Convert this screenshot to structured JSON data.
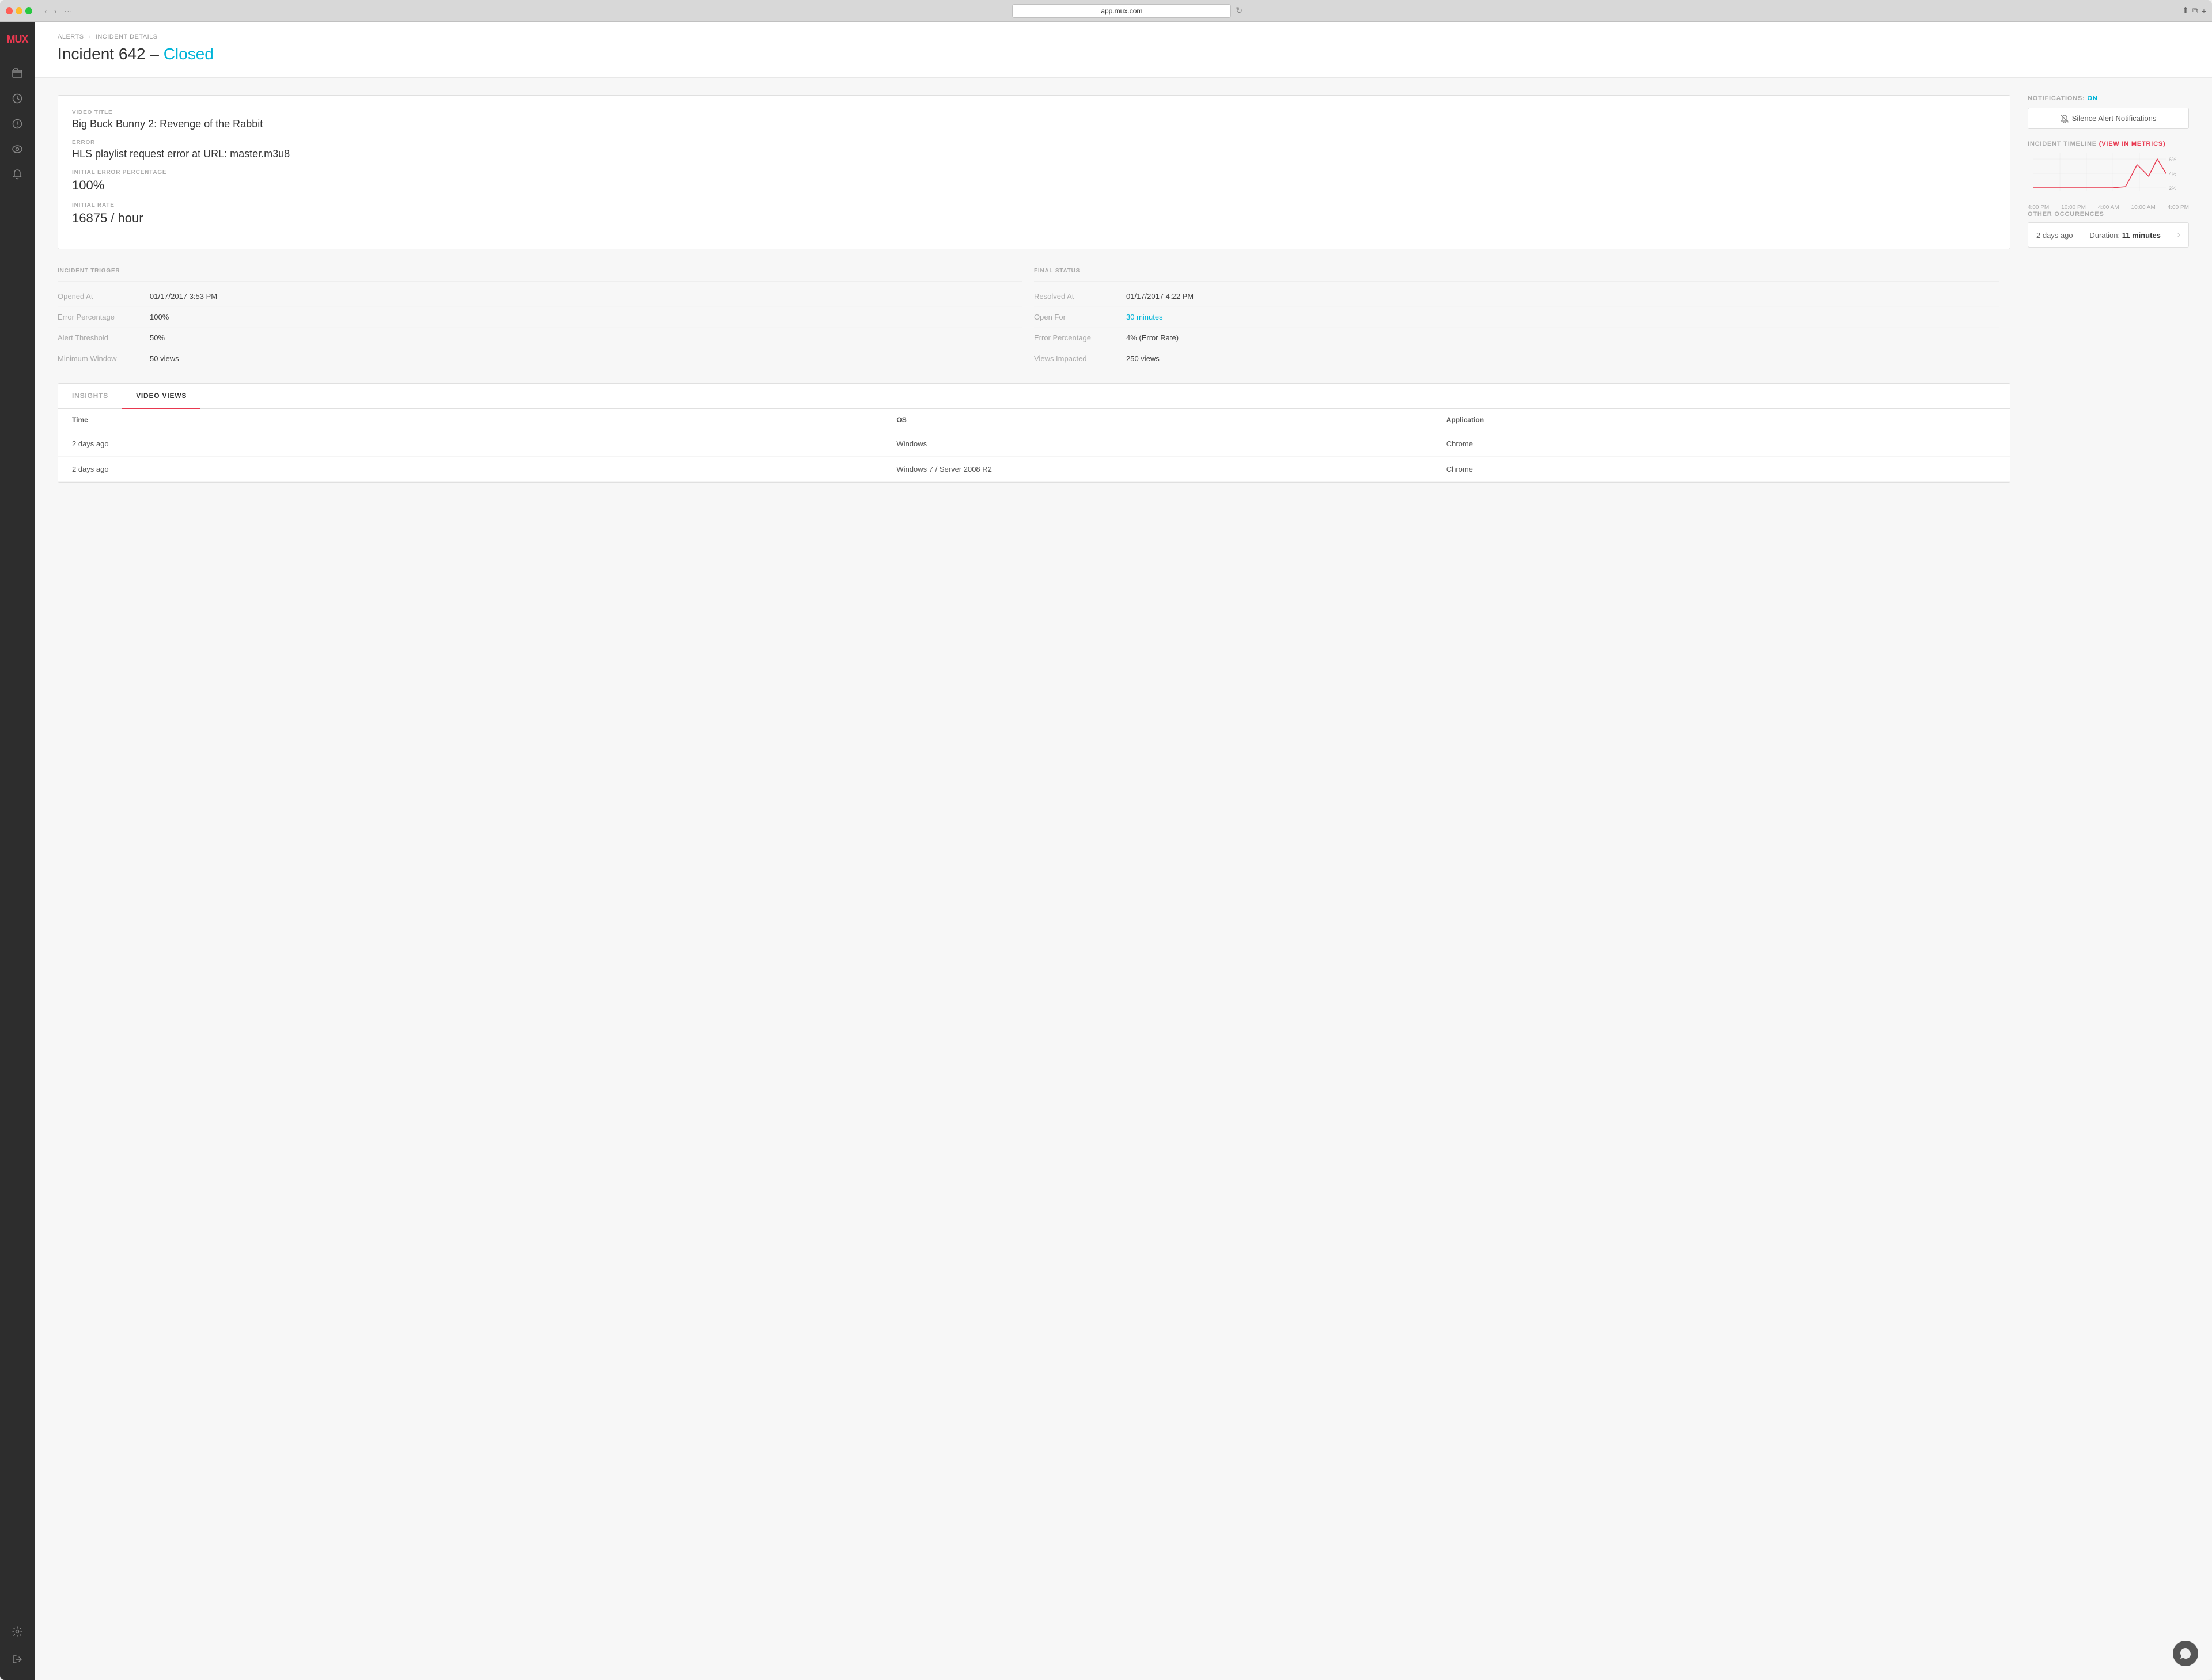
{
  "browser": {
    "url": "app.mux.com",
    "traffic_lights": [
      "red",
      "yellow",
      "green"
    ],
    "tab_dots": "···"
  },
  "sidebar": {
    "logo": "MUX",
    "icons": [
      {
        "name": "folder-icon",
        "symbol": "⬚"
      },
      {
        "name": "clock-icon",
        "symbol": "○"
      },
      {
        "name": "alert-icon",
        "symbol": "⊙"
      },
      {
        "name": "eye-icon",
        "symbol": "◎"
      },
      {
        "name": "bell-icon",
        "symbol": "🔔"
      }
    ],
    "bottom_icons": [
      {
        "name": "settings-icon",
        "symbol": "⚙"
      },
      {
        "name": "logout-icon",
        "symbol": "⏎"
      }
    ]
  },
  "breadcrumb": {
    "parent": "ALERTS",
    "separator": "›",
    "current": "INCIDENT DETAILS"
  },
  "page": {
    "title": "Incident 642 – ",
    "status": "Closed"
  },
  "incident_info": {
    "video_title_label": "VIDEO TITLE",
    "video_title": "Big Buck Bunny 2: Revenge of the Rabbit",
    "error_label": "ERROR",
    "error": "HLS playlist request error at URL: master.m3u8",
    "error_percentage_label": "INITIAL ERROR PERCENTAGE",
    "error_percentage": "100%",
    "initial_rate_label": "INITIAL RATE",
    "initial_rate": "16875 / hour"
  },
  "incident_details": {
    "trigger_header": "INCIDENT TRIGGER",
    "final_header": "FINAL STATUS",
    "trigger_rows": [
      {
        "key": "Opened At",
        "value": "01/17/2017 3:53 PM"
      },
      {
        "key": "Error Percentage",
        "value": "100%"
      },
      {
        "key": "Alert Threshold",
        "value": "50%"
      },
      {
        "key": "Minimum Window",
        "value": "50 views"
      }
    ],
    "final_rows": [
      {
        "key": "Resolved At",
        "value": "01/17/2017 4:22 PM",
        "link": false
      },
      {
        "key": "Open For",
        "value": "30 minutes",
        "link": true
      },
      {
        "key": "Error Percentage",
        "value": "4% (Error Rate)",
        "link": false
      },
      {
        "key": "Views Impacted",
        "value": "250 views",
        "link": false
      }
    ]
  },
  "tabs": {
    "items": [
      {
        "label": "INSIGHTS",
        "active": false
      },
      {
        "label": "VIDEO VIEWS",
        "active": true
      }
    ],
    "table": {
      "headers": [
        "Time",
        "OS",
        "Application"
      ],
      "rows": [
        [
          "2 days ago",
          "Windows",
          "Chrome"
        ],
        [
          "2 days ago",
          "Windows 7 / Server 2008 R2",
          "Chrome"
        ]
      ]
    }
  },
  "notifications": {
    "label": "NOTIFICATIONS:",
    "status": "ON",
    "silence_btn": "Silence Alert Notifications"
  },
  "timeline": {
    "label": "INCIDENT TIMELINE",
    "link_text": "(View in metrics)",
    "x_labels": [
      "4:00 PM",
      "10:00 PM",
      "4:00 AM",
      "10:00 AM",
      "4:00 PM"
    ],
    "y_labels": [
      "6%",
      "4%",
      "2%"
    ]
  },
  "other_occurrences": {
    "label": "OTHER OCCURENCES",
    "rows": [
      {
        "time": "2 days ago",
        "duration_label": "Duration:",
        "duration": "11 minutes"
      }
    ]
  },
  "chat": {
    "icon": "💬"
  }
}
